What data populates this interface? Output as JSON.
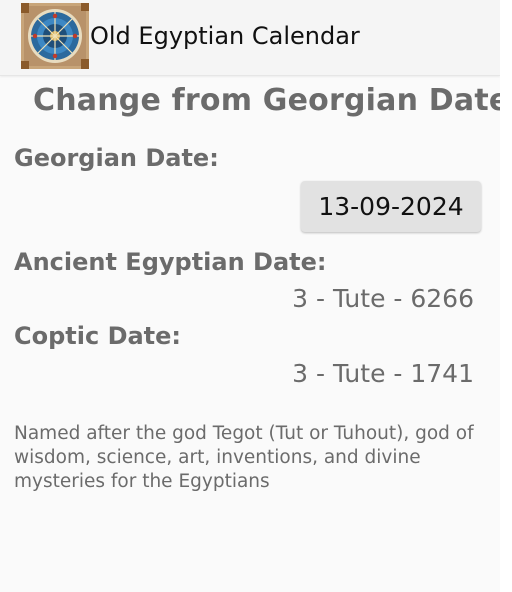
{
  "appbar": {
    "title": "Old Egyptian Calendar",
    "logo_icon": "egyptian-zodiac-logo-icon"
  },
  "page": {
    "title": "Change from Georgian Date"
  },
  "georgian": {
    "label": "Georgian Date:",
    "value": "13-09-2024"
  },
  "ancient": {
    "label": "Ancient Egyptian Date:",
    "value": "3 - Tute - 6266"
  },
  "coptic": {
    "label": "Coptic Date:",
    "value": "3 - Tute - 1741"
  },
  "description": "Named after the god Tegot (Tut or Tuhout), god of wisdom, science, art, inventions, and divine mysteries for the Egyptians",
  "colors": {
    "background": "#fafafa",
    "appbar": "#f5f5f5",
    "text_gray": "#6b6b6b",
    "button_bg": "#e2e2e2"
  }
}
